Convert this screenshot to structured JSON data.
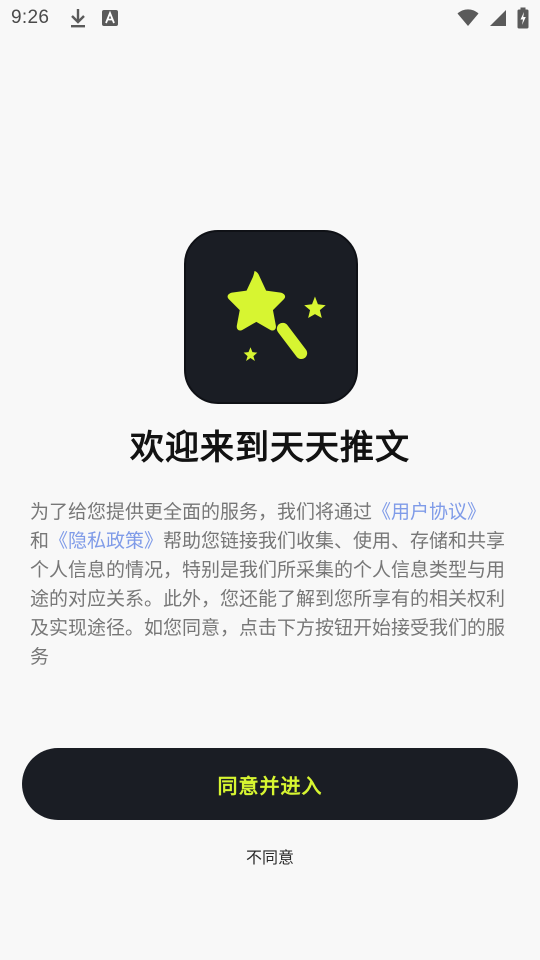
{
  "status_bar": {
    "time": "9:26",
    "left_icons": [
      "download-icon",
      "font-a-icon"
    ],
    "right_icons": [
      "wifi-icon",
      "signal-icon",
      "battery-charging-icon"
    ]
  },
  "app": {
    "icon": "magic-wand-star-icon",
    "title": "欢迎来到天天推文"
  },
  "intro": {
    "text_before": "为了给您提供更全面的服务，我们将通过",
    "link_user_agreement": "《用户协议》",
    "text_and": "和",
    "link_privacy_policy": "《隐私政策》",
    "text_after": "帮助您链接我们收集、使用、存储和共享个人信息的情况，特别是我们所采集的个人信息类型与用途的对应关系。此外，您还能了解到您所享有的相关权利及实现途径。如您同意，点击下方按钮开始接受我们的服务"
  },
  "buttons": {
    "agree": "同意并进入",
    "disagree": "不同意"
  },
  "colors": {
    "background": "#f8f8f8",
    "dark": "#1a1d24",
    "accent_lime": "#d7f531",
    "link_blue": "#7f9be8",
    "body_text": "#777777"
  }
}
